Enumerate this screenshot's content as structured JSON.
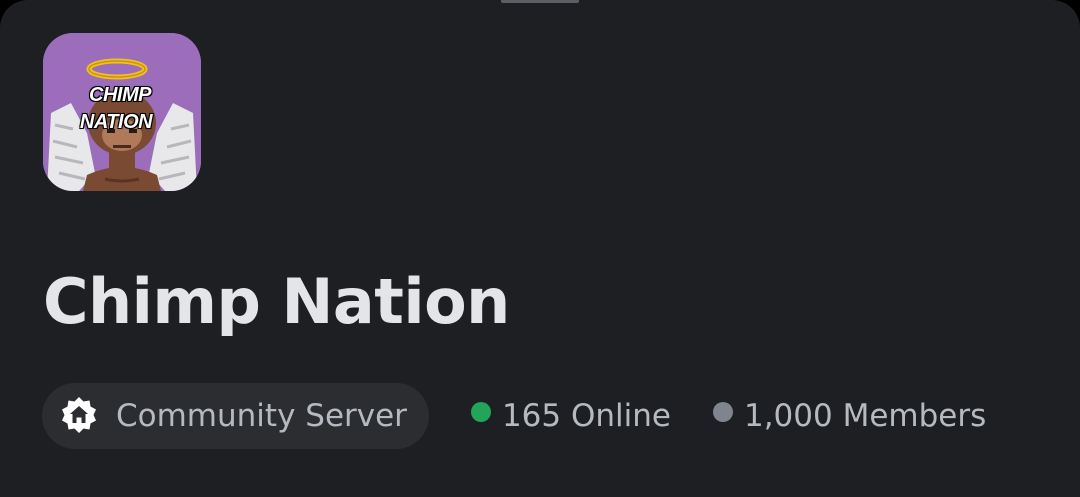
{
  "server": {
    "name": "Chimp Nation",
    "icon_name": "chimp-angel-icon",
    "logo_text_line1": "CHIMP",
    "logo_text_line2": "NATION",
    "type_label": "Community Server",
    "type_icon": "home-shield-icon",
    "online_text": "165 Online",
    "members_text": "1,000 Members"
  },
  "colors": {
    "background": "#1e1f22",
    "pill": "#2b2d31",
    "online": "#23a559",
    "members": "#80848e",
    "icon_bg": "#9b6dba"
  }
}
